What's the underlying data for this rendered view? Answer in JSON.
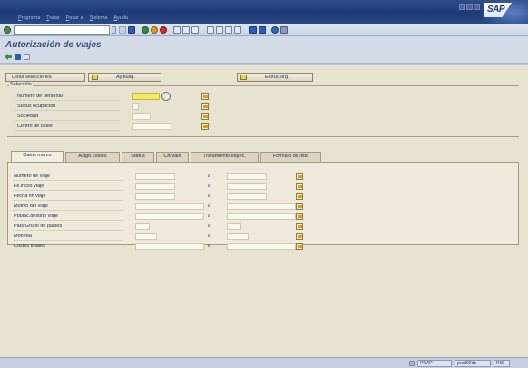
{
  "menu": [
    "Programa",
    "Tratar",
    "Pasar a",
    "Sistema",
    "Ayuda"
  ],
  "window": {
    "logo": "SAP"
  },
  "page": {
    "title": "Autorización de viajes"
  },
  "buttons": {
    "other_selections": "Otras selecciones",
    "search_help": "Ay.búsq.",
    "org_structure": "Estruc.org."
  },
  "selection": {
    "frame_title": "Selección",
    "fields": [
      {
        "label": "Número de personal"
      },
      {
        "label": "Status ocupación"
      },
      {
        "label": "Sociedad"
      },
      {
        "label": "Centro de coste"
      }
    ]
  },
  "tabs": [
    "Datos marco",
    "Asign.costes",
    "Status",
    "Ch/Vale",
    "Tratamiento espec.",
    "Formato de lista"
  ],
  "trip_fields": {
    "range_separator": "a",
    "rows": [
      {
        "label": "Número de viaje"
      },
      {
        "label": "Fe.inicio viaje"
      },
      {
        "label": "Fecha fin viaje"
      },
      {
        "label": "Motivo del viaje"
      },
      {
        "label": "Poblac.destino viaje"
      },
      {
        "label": "País/Grupo de países"
      },
      {
        "label": "Moneda"
      },
      {
        "label": "Costes totales"
      }
    ]
  },
  "status": {
    "system": "PRAP",
    "server": "prod02db",
    "mode": "INS"
  },
  "colors": {
    "title_bar": "#1d3a74",
    "content_bg": "#e8e2d0",
    "required_field": "#f6e86c"
  }
}
